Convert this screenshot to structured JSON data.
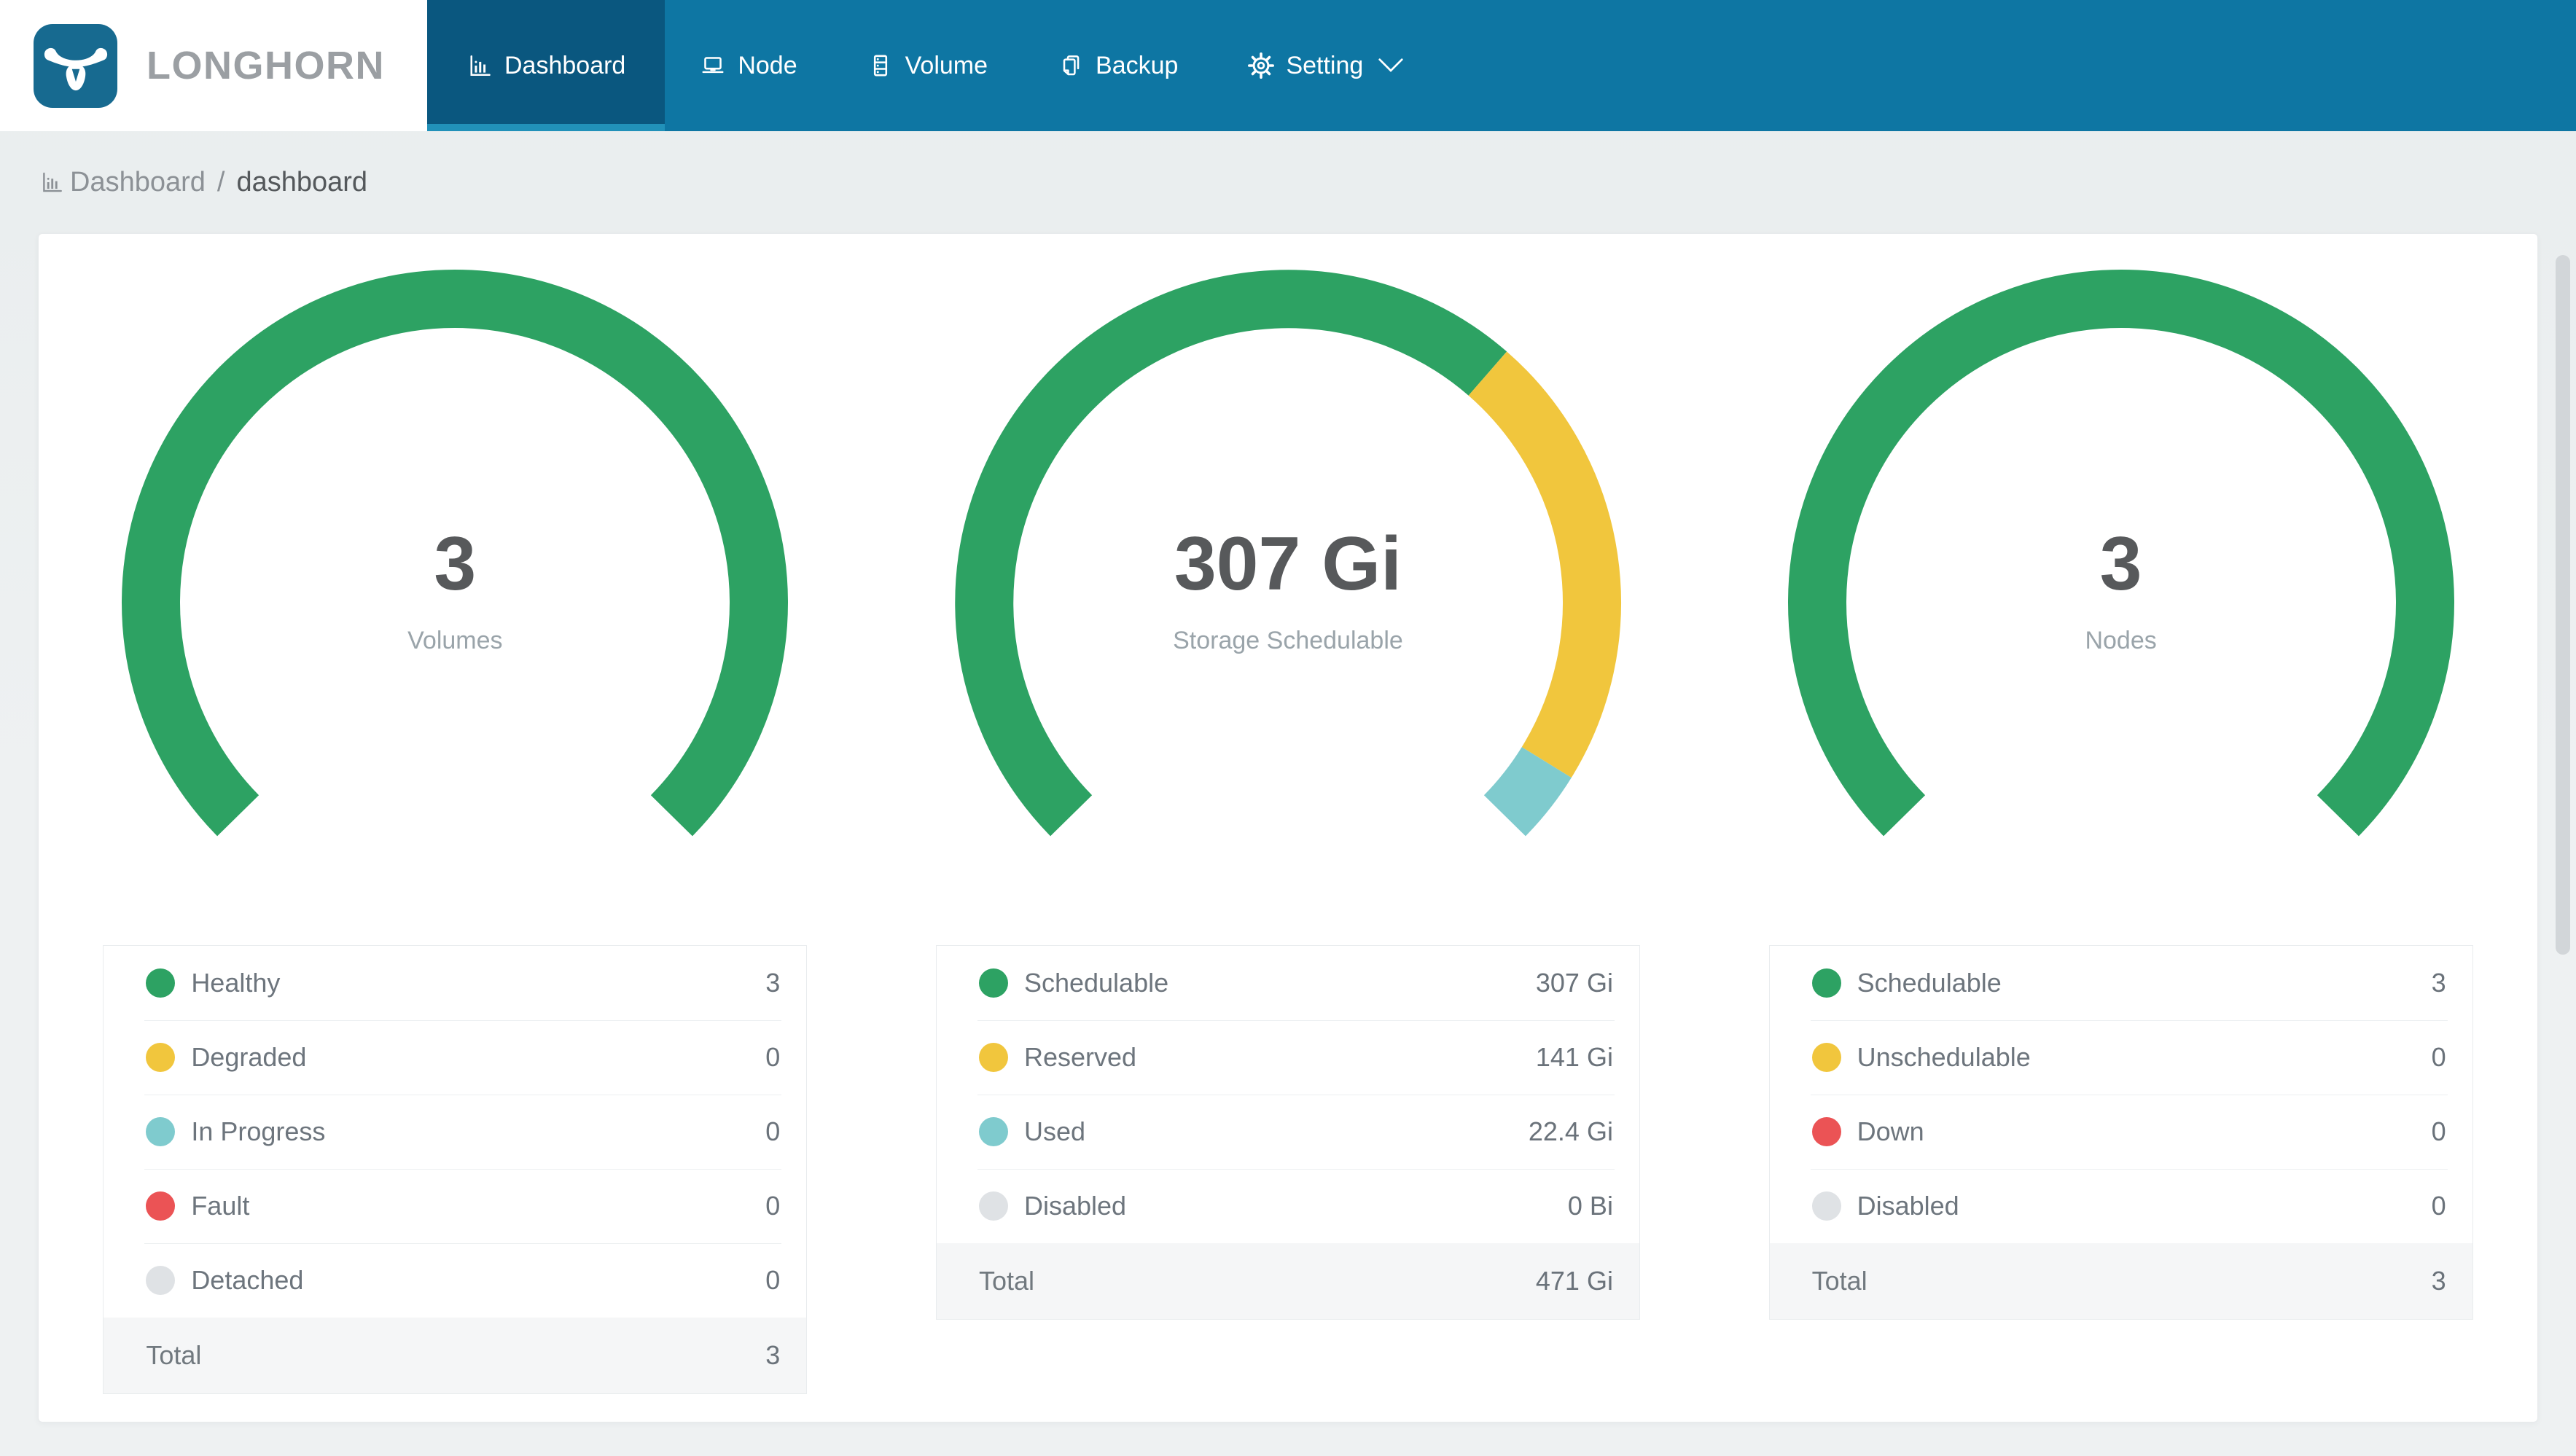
{
  "app": {
    "brand": "LONGHORN"
  },
  "colors": {
    "nav_background": "#0E76A3",
    "nav_active_background": "#0A577F",
    "nav_active_underline": "#2191B9",
    "logo_background": "#176A90",
    "healthy_green": "#2DA263",
    "warning_yellow": "#F1C63D",
    "progress_teal": "#7FCBCE",
    "fault_red": "#EB5355",
    "disabled_gray": "#DFE2E5"
  },
  "nav": {
    "items": [
      {
        "label": "Dashboard",
        "icon": "bar-chart-icon",
        "active": true
      },
      {
        "label": "Node",
        "icon": "laptop-icon",
        "active": false
      },
      {
        "label": "Volume",
        "icon": "server-icon",
        "active": false
      },
      {
        "label": "Backup",
        "icon": "copy-icon",
        "active": false
      },
      {
        "label": "Setting",
        "icon": "gear-icon",
        "active": false,
        "has_caret": true
      }
    ]
  },
  "breadcrumb": {
    "section": "Dashboard",
    "separator": "/",
    "page": "dashboard"
  },
  "gauge": {
    "start_angle": 225.5,
    "sweep": 269
  },
  "cards": [
    {
      "center_value": "3",
      "center_label": "Volumes",
      "segments": [
        {
          "name": "Healthy",
          "value": 3,
          "color": "#2DA263"
        },
        {
          "name": "Degraded",
          "value": 0,
          "color": "#F1C63D"
        },
        {
          "name": "In Progress",
          "value": 0,
          "color": "#7FCBCE"
        },
        {
          "name": "Fault",
          "value": 0,
          "color": "#EB5355"
        },
        {
          "name": "Detached",
          "value": 0,
          "color": "#DFE2E5"
        }
      ],
      "legend": [
        {
          "label": "Healthy",
          "value": "3",
          "color": "#2DA263"
        },
        {
          "label": "Degraded",
          "value": "0",
          "color": "#F1C63D"
        },
        {
          "label": "In Progress",
          "value": "0",
          "color": "#7FCBCE"
        },
        {
          "label": "Fault",
          "value": "0",
          "color": "#EB5355"
        },
        {
          "label": "Detached",
          "value": "0",
          "color": "#DFE2E5"
        }
      ],
      "total_label": "Total",
      "total_value": "3"
    },
    {
      "center_value": "307 Gi",
      "center_label": "Storage Schedulable",
      "segments": [
        {
          "name": "Schedulable",
          "value": 307,
          "color": "#2DA263"
        },
        {
          "name": "Reserved",
          "value": 141,
          "color": "#F1C63D"
        },
        {
          "name": "Used",
          "value": 22.4,
          "color": "#7FCBCE"
        },
        {
          "name": "Disabled",
          "value": 0,
          "color": "#DFE2E5"
        }
      ],
      "legend": [
        {
          "label": "Schedulable",
          "value": "307 Gi",
          "color": "#2DA263"
        },
        {
          "label": "Reserved",
          "value": "141 Gi",
          "color": "#F1C63D"
        },
        {
          "label": "Used",
          "value": "22.4 Gi",
          "color": "#7FCBCE"
        },
        {
          "label": "Disabled",
          "value": "0 Bi",
          "color": "#DFE2E5"
        }
      ],
      "total_label": "Total",
      "total_value": "471 Gi"
    },
    {
      "center_value": "3",
      "center_label": "Nodes",
      "segments": [
        {
          "name": "Schedulable",
          "value": 3,
          "color": "#2DA263"
        },
        {
          "name": "Unschedulable",
          "value": 0,
          "color": "#F1C63D"
        },
        {
          "name": "Down",
          "value": 0,
          "color": "#EB5355"
        },
        {
          "name": "Disabled",
          "value": 0,
          "color": "#DFE2E5"
        }
      ],
      "legend": [
        {
          "label": "Schedulable",
          "value": "3",
          "color": "#2DA263"
        },
        {
          "label": "Unschedulable",
          "value": "0",
          "color": "#F1C63D"
        },
        {
          "label": "Down",
          "value": "0",
          "color": "#EB5355"
        },
        {
          "label": "Disabled",
          "value": "0",
          "color": "#DFE2E5"
        }
      ],
      "total_label": "Total",
      "total_value": "3"
    }
  ]
}
